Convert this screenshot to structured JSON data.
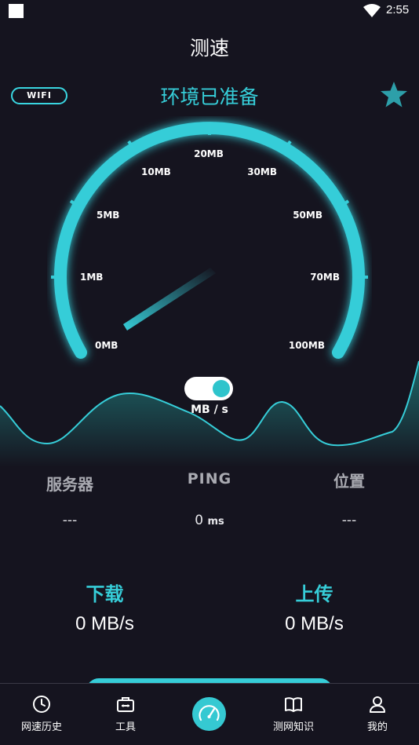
{
  "status_bar": {
    "time": "2:55"
  },
  "header": {
    "title": "测速"
  },
  "top": {
    "wifi_badge": "WIFI",
    "env_status": "环境已准备"
  },
  "gauge": {
    "ticks": [
      {
        "label": "0MB"
      },
      {
        "label": "1MB"
      },
      {
        "label": "5MB"
      },
      {
        "label": "10MB"
      },
      {
        "label": "20MB"
      },
      {
        "label": "30MB"
      },
      {
        "label": "50MB"
      },
      {
        "label": "70MB"
      },
      {
        "label": "100MB"
      }
    ],
    "unit": "MB / s",
    "accent": "#36cdd8"
  },
  "stats": {
    "server_label": "服务器",
    "ping_label": "PING",
    "location_label": "位置",
    "server_value": "---",
    "ping_value": "0",
    "ping_unit": "ms",
    "location_value": "---"
  },
  "transfer": {
    "download_label": "下载",
    "download_value": "0 MB/s",
    "upload_label": "上传",
    "upload_value": "0 MB/s"
  },
  "nav": {
    "items": [
      {
        "label": "网速历史",
        "icon": "clock-icon"
      },
      {
        "label": "工具",
        "icon": "toolbox-icon"
      },
      {
        "label": "",
        "icon": "speedometer-icon"
      },
      {
        "label": "测网知识",
        "icon": "book-icon"
      },
      {
        "label": "我的",
        "icon": "user-icon"
      }
    ]
  }
}
